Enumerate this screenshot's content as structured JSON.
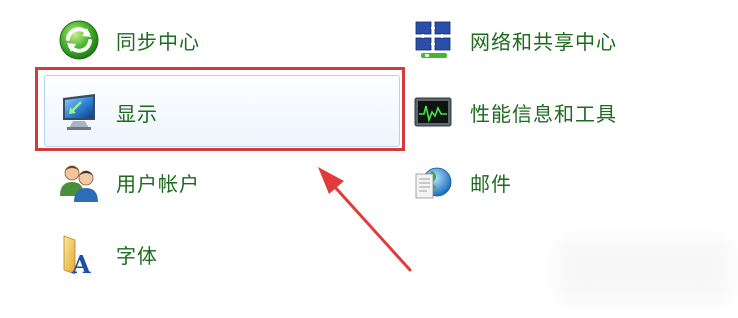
{
  "items": {
    "sync": {
      "label": "同步中心",
      "icon": "sync-center-icon"
    },
    "display": {
      "label": "显示",
      "icon": "display-monitor-icon"
    },
    "users": {
      "label": "用户帐户",
      "icon": "user-accounts-icon"
    },
    "fonts": {
      "label": "字体",
      "icon": "fonts-folder-icon"
    },
    "network": {
      "label": "网络和共享中心",
      "icon": "network-sharing-icon"
    },
    "perf": {
      "label": "性能信息和工具",
      "icon": "performance-tools-icon"
    },
    "mail": {
      "label": "邮件",
      "icon": "mail-icon"
    }
  },
  "colors": {
    "link_text": "#1e6a1e",
    "highlight": "#d33a3a",
    "hover_border": "#b8d2ee"
  }
}
